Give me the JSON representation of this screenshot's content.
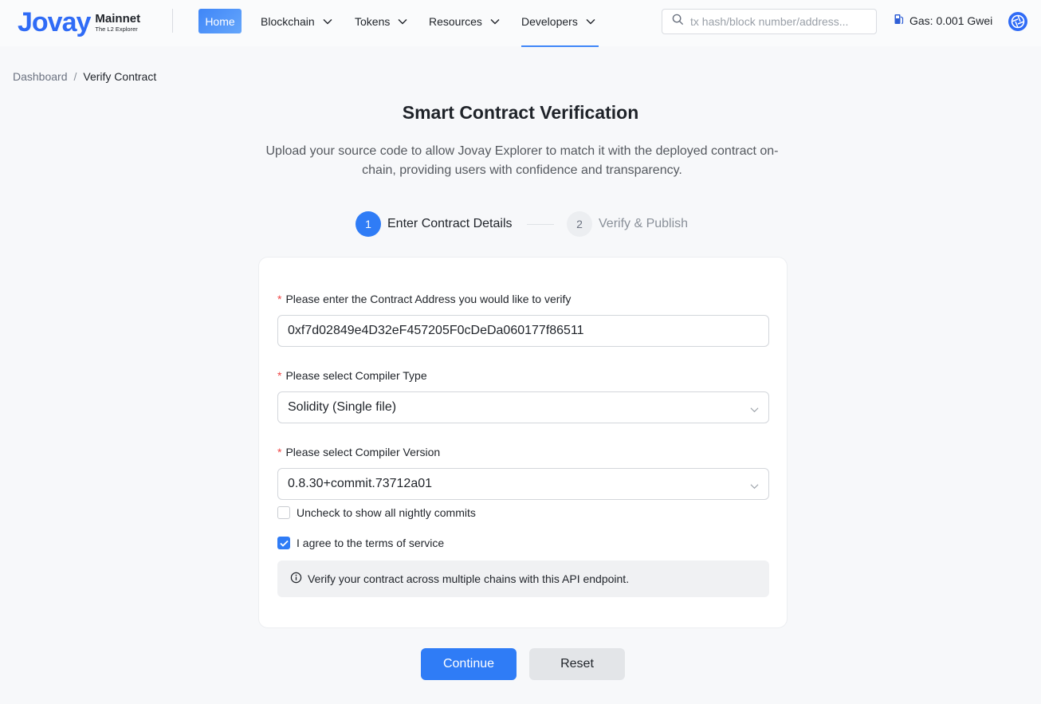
{
  "header": {
    "logo_text": "Jovay",
    "network": "Mainnet",
    "tagline": "The L2 Explorer",
    "nav": [
      {
        "label": "Home",
        "active": true
      },
      {
        "label": "Blockchain"
      },
      {
        "label": "Tokens"
      },
      {
        "label": "Resources"
      },
      {
        "label": "Developers",
        "selected": true
      }
    ],
    "search_placeholder": "tx hash/block number/address...",
    "gas": "Gas: 0.001 Gwei",
    "icons": {
      "search": "search-icon",
      "gas": "gas-pump-icon",
      "network": "network-globe-icon",
      "dropdown": "chevron-down-icon"
    }
  },
  "breadcrumb": {
    "root": "Dashboard",
    "separator": "/",
    "current": "Verify Contract"
  },
  "page": {
    "title": "Smart Contract Verification",
    "description": "Upload your source code to allow Jovay Explorer to match it with the deployed contract on-chain, providing users with confidence and transparency."
  },
  "steps": [
    {
      "number": "1",
      "label": "Enter Contract Details",
      "active": true
    },
    {
      "number": "2",
      "label": "Verify & Publish",
      "active": false
    }
  ],
  "form": {
    "address_label": "Please enter the Contract Address you would like to verify",
    "address_value": "0xf7d02849e4D32eF457205F0cDeDa060177f86511",
    "compiler_type_label": "Please select Compiler Type",
    "compiler_type_value": "Solidity (Single file)",
    "compiler_version_label": "Please select Compiler Version",
    "compiler_version_value": "0.8.30+commit.73712a01",
    "nightly_label": "Uncheck to show all nightly commits",
    "nightly_checked": false,
    "terms_label": "I agree to the terms of service",
    "terms_checked": true,
    "info_text": "Verify your contract across multiple chains with this API endpoint.",
    "required_mark": "*"
  },
  "actions": {
    "continue_label": "Continue",
    "reset_label": "Reset"
  },
  "colors": {
    "accent": "#2f7cf6",
    "required": "#ef4444",
    "page_bg": "#f7f8fa"
  }
}
